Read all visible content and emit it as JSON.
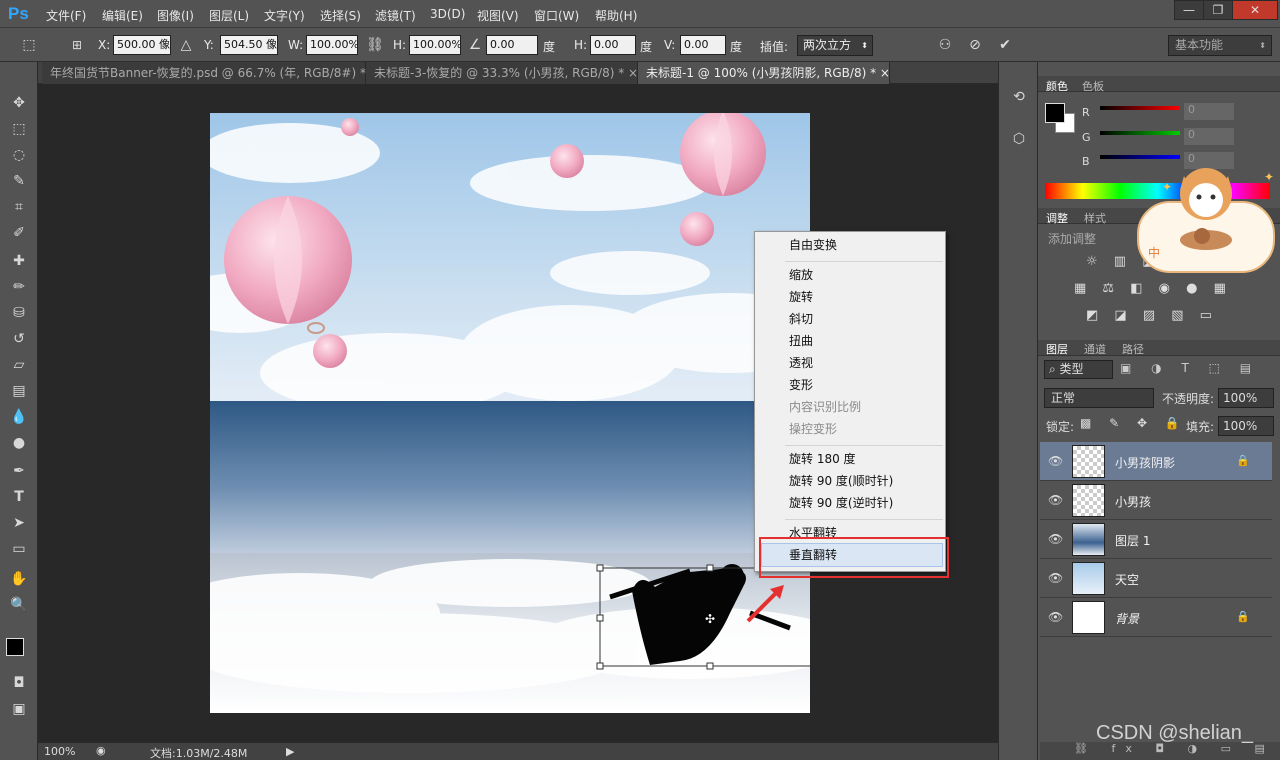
{
  "app": {
    "logo": "Ps"
  },
  "menu": [
    "文件(F)",
    "编辑(E)",
    "图像(I)",
    "图层(L)",
    "文字(Y)",
    "选择(S)",
    "滤镜(T)",
    "3D(D)",
    "视图(V)",
    "窗口(W)",
    "帮助(H)"
  ],
  "window_controls": {
    "minimize": "—",
    "restore": "❐",
    "close": "✕"
  },
  "options": {
    "x_label": "X:",
    "x_value": "500.00 像",
    "y_label": "Y:",
    "y_value": "504.50 像",
    "w_label": "W:",
    "w_value": "100.00%",
    "h_label": "H:",
    "h_value": "100.00%",
    "angle_value": "0.00",
    "angle_unit": "度",
    "hskew_label": "H:",
    "hskew_value": "0.00",
    "hskew_unit": "度",
    "vskew_label": "V:",
    "vskew_value": "0.00",
    "vskew_unit": "度",
    "interp_label": "插值:",
    "interp_value": "两次立方",
    "workspace": "基本功能"
  },
  "tabs": [
    {
      "label": "年终国货节Banner-恢复的.psd @ 66.7% (年, RGB/8#) *",
      "close": "×"
    },
    {
      "label": "未标题-3-恢复的 @ 33.3% (小男孩, RGB/8) *",
      "close": "×"
    },
    {
      "label": "未标题-1 @ 100% (小男孩阴影, RGB/8) *",
      "close": "×"
    }
  ],
  "status": {
    "zoom": "100%",
    "doc": "文档:1.03M/2.48M"
  },
  "context_menu": {
    "items": [
      {
        "label": "自由变换",
        "disabled": false
      },
      {
        "label": "缩放",
        "disabled": false
      },
      {
        "label": "旋转",
        "disabled": false
      },
      {
        "label": "斜切",
        "disabled": false
      },
      {
        "label": "扭曲",
        "disabled": false
      },
      {
        "label": "透视",
        "disabled": false
      },
      {
        "label": "变形",
        "disabled": false
      },
      {
        "label": "内容识别比例",
        "disabled": true
      },
      {
        "label": "操控变形",
        "disabled": true
      },
      {
        "label": "旋转 180 度",
        "disabled": false
      },
      {
        "label": "旋转 90 度(顺时针)",
        "disabled": false
      },
      {
        "label": "旋转 90 度(逆时针)",
        "disabled": false
      },
      {
        "label": "水平翻转",
        "disabled": false
      },
      {
        "label": "垂直翻转",
        "disabled": false
      }
    ]
  },
  "color_panel": {
    "tabs": [
      "颜色",
      "色板"
    ],
    "channels": [
      {
        "label": "R",
        "value": "0"
      },
      {
        "label": "G",
        "value": "0"
      },
      {
        "label": "B",
        "value": "0"
      }
    ]
  },
  "adjust_panel": {
    "tabs": [
      "调整",
      "样式"
    ],
    "title": "添加调整"
  },
  "layers_panel": {
    "tabs": [
      "图层",
      "通道",
      "路径"
    ],
    "filter": "类型",
    "blend": "正常",
    "opacity_label": "不透明度:",
    "opacity": "100%",
    "lock_label": "锁定:",
    "fill_label": "填充:",
    "fill": "100%",
    "layers": [
      {
        "name": "小男孩阴影",
        "selected": true,
        "locked": true
      },
      {
        "name": "小男孩",
        "selected": false,
        "locked": false
      },
      {
        "name": "图层 1",
        "selected": false,
        "locked": false
      },
      {
        "name": "天空",
        "selected": false,
        "locked": false
      },
      {
        "name": "背景",
        "selected": false,
        "locked": true
      }
    ]
  },
  "sticker": {
    "bubble_text": "中",
    "sparkles": "✦"
  },
  "watermark": "CSDN @shelian_",
  "colors": {
    "accent_red": "#e53030",
    "ps_blue": "#31a8ff",
    "selected_layer": "#6a7b93"
  }
}
